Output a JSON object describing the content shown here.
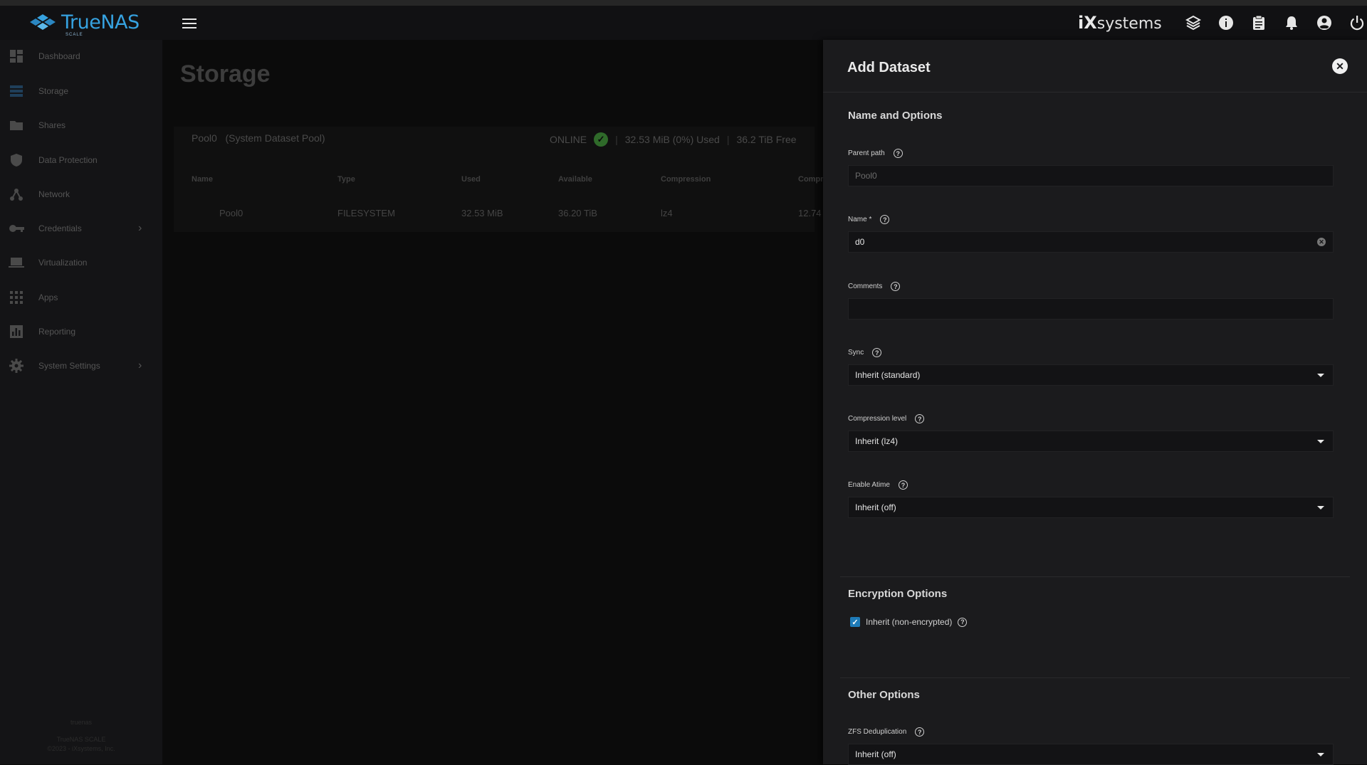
{
  "topbar": {
    "logo_text": "TrueNAS",
    "logo_sub": "SCALE",
    "brand_ix": "iX",
    "brand_systems": "systems",
    "icons": [
      "hamburger-icon",
      "truecommand-icon",
      "info-icon",
      "clipboard-icon",
      "bell-icon",
      "account-icon",
      "power-icon"
    ]
  },
  "sidebar": {
    "items": [
      {
        "label": "Dashboard",
        "icon": "dashboard-icon"
      },
      {
        "label": "Storage",
        "icon": "storage-icon"
      },
      {
        "label": "Shares",
        "icon": "shares-icon"
      },
      {
        "label": "Data Protection",
        "icon": "shield-icon"
      },
      {
        "label": "Network",
        "icon": "network-icon"
      },
      {
        "label": "Credentials",
        "icon": "key-icon"
      },
      {
        "label": "Virtualization",
        "icon": "laptop-icon"
      },
      {
        "label": "Apps",
        "icon": "apps-grid-icon"
      },
      {
        "label": "Reporting",
        "icon": "chart-icon"
      },
      {
        "label": "System Settings",
        "icon": "gear-icon"
      }
    ],
    "footer_host": "truenas",
    "footer_product": "TrueNAS SCALE",
    "footer_copyright": "©2023 - iXsystems, Inc."
  },
  "main": {
    "title": "Storage",
    "pool_name": "Pool0",
    "pool_role": "(System Dataset Pool)",
    "pool_state": "ONLINE",
    "pool_used": "32.53 MiB (0%) Used",
    "pool_free": "36.2 TiB Free",
    "table": {
      "headers": [
        "Name",
        "Type",
        "Used",
        "Available",
        "Compression",
        "Compr"
      ],
      "row": [
        "Pool0",
        "FILESYSTEM",
        "32.53 MiB",
        "36.20 TiB",
        "lz4",
        "12.74"
      ]
    }
  },
  "panel": {
    "title": "Add Dataset",
    "section_name_options": "Name and Options",
    "parent_path_label": "Parent path",
    "parent_path_value": "Pool0",
    "name_label": "Name *",
    "name_value": "d0",
    "comments_label": "Comments",
    "comments_value": "",
    "sync_label": "Sync",
    "sync_value": "Inherit (standard)",
    "compression_label": "Compression level",
    "compression_value": "Inherit (lz4)",
    "atime_label": "Enable Atime",
    "atime_value": "Inherit (off)",
    "section_encryption": "Encryption Options",
    "encryption_checkbox_label": "Inherit (non-encrypted)",
    "encryption_checked": true,
    "section_other": "Other Options",
    "dedup_label": "ZFS Deduplication",
    "dedup_value": "Inherit (off)"
  },
  "colors": {
    "accent": "#1e7bb8",
    "logo": "#36a2e0",
    "panel_bg": "#1b1b1d",
    "online": "#2f6a2a"
  }
}
